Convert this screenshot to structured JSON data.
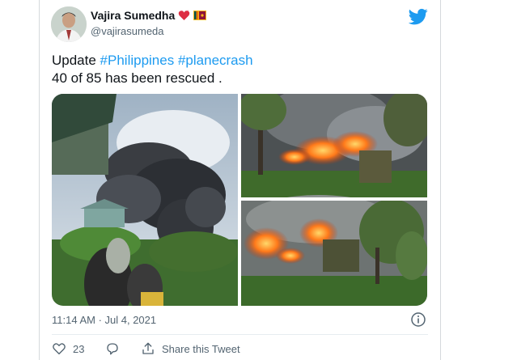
{
  "tweet": {
    "author_name": "Vajira Sumedha",
    "author_emojis": [
      "red-heart-bird-icon",
      "sri-lanka-flag-icon"
    ],
    "handle": "@vajirasumeda",
    "text_prefix": "Update ",
    "hashtags": [
      "#Philippines",
      "#planecrash"
    ],
    "text_line2": "40 of 85 has been rescued .",
    "timestamp": "11:14 AM · Jul 4, 2021",
    "like_count": "23",
    "share_label": "Share this Tweet"
  },
  "media": {
    "images": [
      "smoke-plume-photo",
      "crash-fire-photo-1",
      "crash-fire-photo-2"
    ]
  },
  "colors": {
    "brand": "#1d9bf0",
    "text": "#0f1419",
    "secondary": "#536471",
    "border": "#d5d9dc"
  }
}
